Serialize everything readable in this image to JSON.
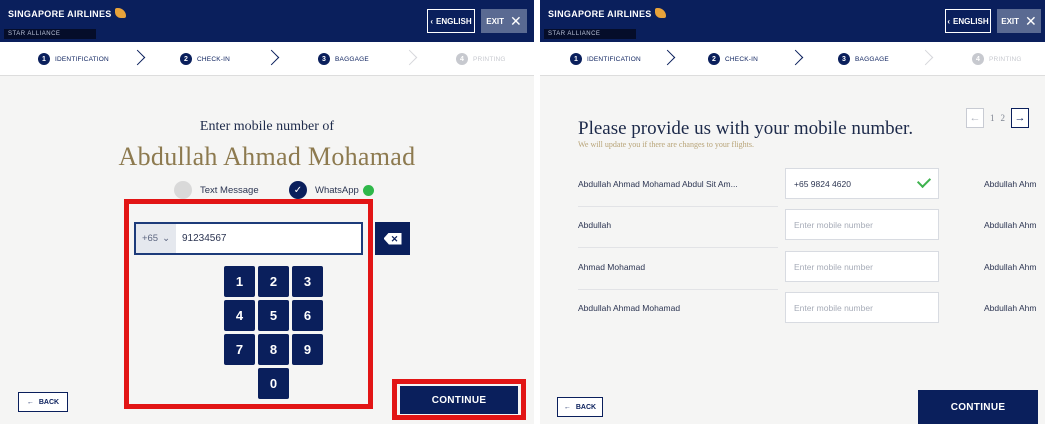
{
  "common": {
    "airline": "SINGAPORE AIRLINES",
    "alliance": "STAR ALLIANCE",
    "lang_label": "ENGLISH",
    "exit_label": "EXIT",
    "back_label": "BACK",
    "continue_label": "CONTINUE",
    "steps": [
      {
        "num": "1",
        "label": "IDENTIFICATION",
        "state": "active"
      },
      {
        "num": "2",
        "label": "CHECK-IN",
        "state": "active"
      },
      {
        "num": "3",
        "label": "BAGGAGE",
        "state": "active"
      },
      {
        "num": "4",
        "label": "PRINTING",
        "state": "inactive"
      }
    ]
  },
  "left": {
    "prompt": "Enter mobile number of",
    "passenger_name": "Abdullah Ahmad Mohamad",
    "options": [
      {
        "label": "Text Message",
        "selected": false
      },
      {
        "label": "WhatsApp",
        "selected": true
      }
    ],
    "country_code": "+65",
    "phone_value": "91234567",
    "keypad": [
      "1",
      "2",
      "3",
      "4",
      "5",
      "6",
      "7",
      "8",
      "9",
      "0"
    ]
  },
  "right": {
    "title": "Please provide us with your mobile number.",
    "subtitle": "We will update you if there are changes to your flights.",
    "page_current": "1",
    "page_next": "2",
    "rows": [
      {
        "name": "Abdullah Ahmad Mohamad Abdul  Sit Am...",
        "value": "+65 9824 4620",
        "placeholder": "",
        "verified": true,
        "right_name": "Abdullah Ahm"
      },
      {
        "name": "Abdullah",
        "value": "",
        "placeholder": "Enter mobile number",
        "verified": false,
        "right_name": "Abdullah Ahm"
      },
      {
        "name": "Ahmad Mohamad",
        "value": "",
        "placeholder": "Enter mobile number",
        "verified": false,
        "right_name": "Abdullah Ahm"
      },
      {
        "name": "Abdullah Ahmad Mohamad",
        "value": "",
        "placeholder": "Enter mobile number",
        "verified": false,
        "right_name": "Abdullah Ahm"
      }
    ]
  },
  "colors": {
    "brand_navy": "#0a1f5c",
    "gold": "#8d7a4f",
    "highlight_red": "#e21515",
    "success_green": "#3fb34f"
  }
}
